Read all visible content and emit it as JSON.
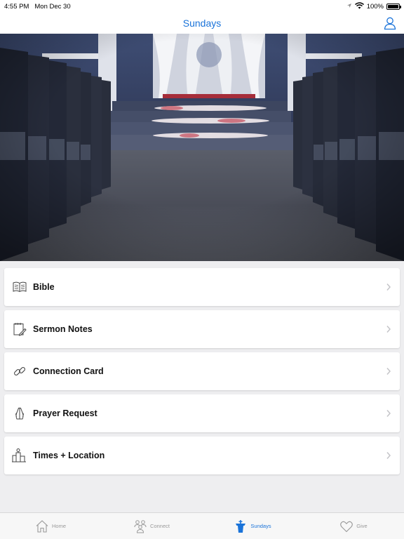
{
  "status_bar": {
    "time": "4:55 PM",
    "date": "Mon Dec 30",
    "battery": "100%"
  },
  "nav": {
    "title": "Sundays",
    "profile_icon": "person-icon"
  },
  "hero": {
    "description_icon": "church-interior-photo"
  },
  "menu": [
    {
      "label": "Bible",
      "icon": "open-book-icon"
    },
    {
      "label": "Sermon Notes",
      "icon": "notepad-pencil-icon"
    },
    {
      "label": "Connection Card",
      "icon": "link-icon"
    },
    {
      "label": "Prayer Request",
      "icon": "praying-hands-icon"
    },
    {
      "label": "Times + Location",
      "icon": "building-location-icon"
    }
  ],
  "tabs": [
    {
      "label": "Home",
      "icon": "house-icon",
      "active": false
    },
    {
      "label": "Connect",
      "icon": "people-icon",
      "active": false
    },
    {
      "label": "Sundays",
      "icon": "pulpit-icon",
      "active": true
    },
    {
      "label": "Give",
      "icon": "heart-icon",
      "active": false
    }
  ],
  "colors": {
    "accent": "#1a73d9",
    "inactive": "#999999",
    "background": "#eeeef0"
  }
}
